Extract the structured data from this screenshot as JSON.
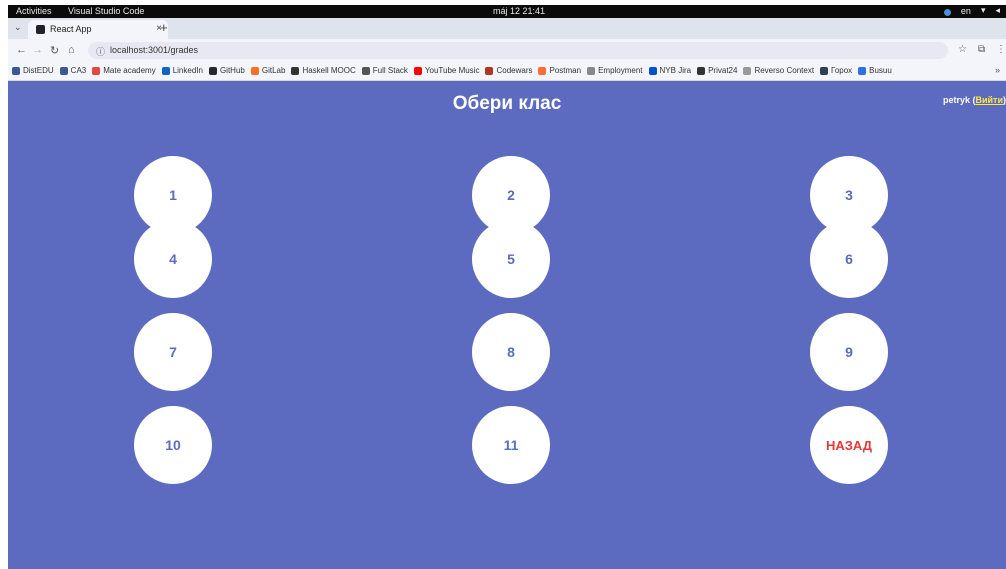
{
  "topbar": {
    "activities": "Activities",
    "app_name": "Visual Studio Code",
    "clock": "máj 12  21:41",
    "language": "en"
  },
  "browser": {
    "tab_title": "React App",
    "url": "localhost:3001/grades",
    "bookmarks": [
      {
        "label": "DistEDU",
        "color": "#3b5998"
      },
      {
        "label": "CA3",
        "color": "#3b5998"
      },
      {
        "label": "Mate academy",
        "color": "#e8453c"
      },
      {
        "label": "LinkedIn",
        "color": "#0a66c2"
      },
      {
        "label": "GitHub",
        "color": "#24292e"
      },
      {
        "label": "GitLab",
        "color": "#fc6d26"
      },
      {
        "label": "Haskell MOOC",
        "color": "#333333"
      },
      {
        "label": "Full Stack",
        "color": "#555555"
      },
      {
        "label": "YouTube Music",
        "color": "#ff0000"
      },
      {
        "label": "Codewars",
        "color": "#b1361e"
      },
      {
        "label": "Postman",
        "color": "#ff6c37"
      },
      {
        "label": "Employment",
        "color": "#888888"
      },
      {
        "label": "NYB Jira",
        "color": "#0052cc"
      },
      {
        "label": "Privat24",
        "color": "#333333"
      },
      {
        "label": "Reverso Context",
        "color": "#999999"
      },
      {
        "label": "Горох",
        "color": "#2e4053"
      },
      {
        "label": "Busuu",
        "color": "#2f6fe4"
      }
    ]
  },
  "page": {
    "title": "Обери клас",
    "username": "petryk",
    "logout_label": "Вийти",
    "grades": [
      "1",
      "2",
      "3",
      "4",
      "5",
      "6",
      "7",
      "8",
      "9",
      "10",
      "11"
    ],
    "back_label": "НАЗАД",
    "colors": {
      "background": "#5c6bc0",
      "circle": "#ffffff",
      "back_text": "#e53935"
    }
  }
}
